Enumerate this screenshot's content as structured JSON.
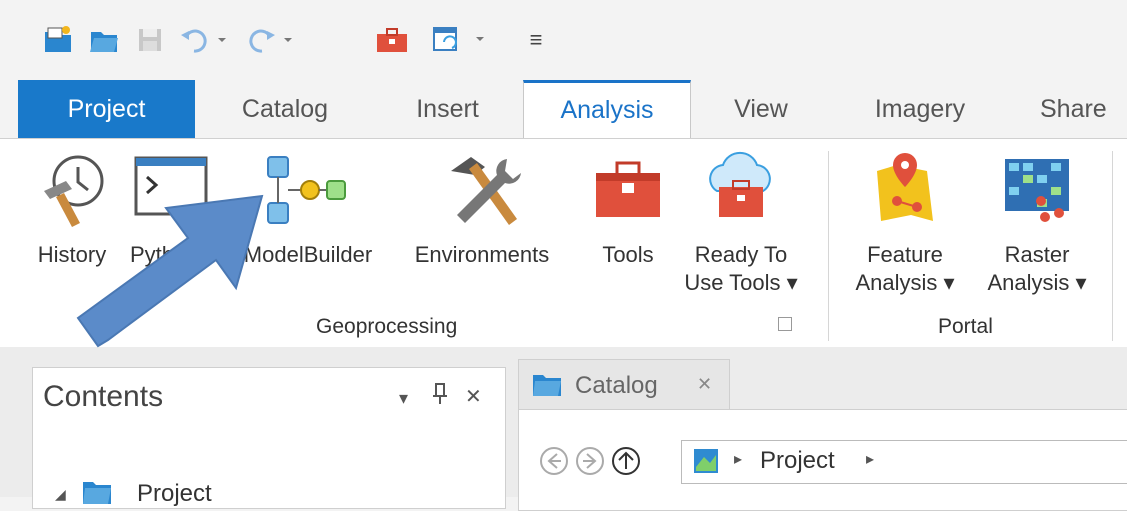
{
  "quick_access": {
    "icons": [
      "new-project-icon",
      "open-project-icon",
      "save-icon",
      "undo-icon",
      "redo-icon",
      "toolbox-icon",
      "window-icon",
      "customize-icon"
    ],
    "customize_glyph": "≡"
  },
  "tabs": [
    {
      "label": "Project"
    },
    {
      "label": "Catalog"
    },
    {
      "label": "Insert"
    },
    {
      "label": "Analysis"
    },
    {
      "label": "View"
    },
    {
      "label": "Imagery"
    },
    {
      "label": "Share"
    }
  ],
  "active_tab": "Analysis",
  "ribbon": {
    "geoprocessing": {
      "label": "Geoprocessing",
      "tools": {
        "history": "History",
        "python": "Pyth",
        "modelbuilder": "ModelBuilder",
        "environments": "Environments",
        "tools": "Tools",
        "ready_line1": "Ready To",
        "ready_line2": "Use Tools ▾"
      }
    },
    "portal": {
      "label": "Portal",
      "feature_line1": "Feature",
      "feature_line2": "Analysis ▾",
      "raster_line1": "Raster",
      "raster_line2": "Analysis ▾"
    }
  },
  "contents_pane": {
    "title": "Contents",
    "controls": {
      "dropdown": "▾",
      "pin": "H",
      "close": "✕"
    },
    "tree_expander": "◢",
    "tree_item": "Project"
  },
  "catalog_view": {
    "tab_label": "Catalog",
    "tab_close": "✕",
    "breadcrumb_sep": "▸",
    "breadcrumb_item": "Project",
    "breadcrumb_sep2": "▸"
  },
  "colors": {
    "accent": "#1a73c8",
    "project_tab": "#1979ca",
    "arrow": "#5b8bc9",
    "toolbox_red": "#e0503c"
  }
}
